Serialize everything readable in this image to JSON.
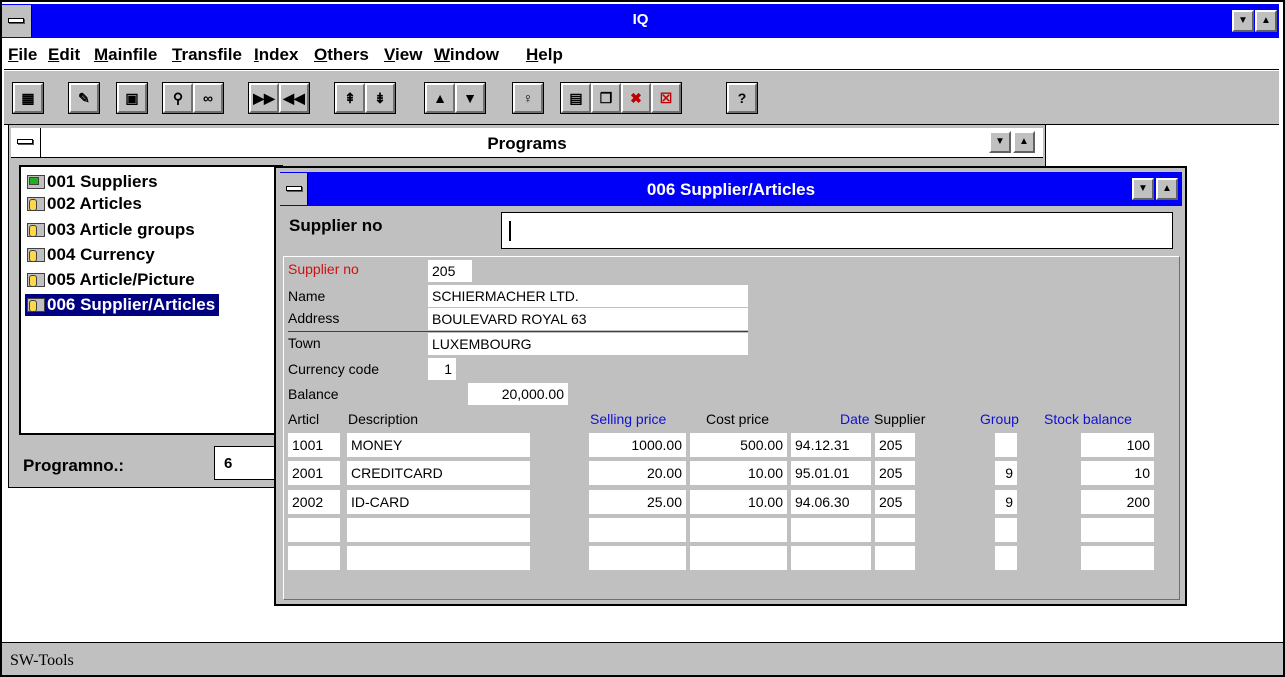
{
  "app": {
    "title": "IQ"
  },
  "menu": [
    "File",
    "Edit",
    "Mainfile",
    "Transfile",
    "Index",
    "Others",
    "View",
    "Window",
    "Help"
  ],
  "menu_underline": [
    "F",
    "E",
    "M",
    "T",
    "I",
    "O",
    "V",
    "W",
    "H"
  ],
  "toolbar": {
    "buttons": [
      "calculator-icon",
      "edit-note-icon",
      "save-icon",
      "search-icon",
      "glasses-icon",
      "next-record-icon",
      "previous-record-icon",
      "first-icon",
      "last-icon",
      "up-icon",
      "down-icon",
      "lightbulb-icon",
      "window-layout-icon",
      "cascade-icon",
      "delete-record-icon",
      "close-record-icon",
      "help-icon"
    ]
  },
  "programs": {
    "title": "Programs",
    "items": [
      {
        "label": "001  Suppliers"
      },
      {
        "label": "002  Articles"
      },
      {
        "label": "003  Article groups"
      },
      {
        "label": "004  Currency"
      },
      {
        "label": "005  Article/Picture"
      },
      {
        "label": "006  Supplier/Articles"
      }
    ],
    "selected_index": 5,
    "programno_label": "Programno.:",
    "programno_value": "6"
  },
  "supplier_window": {
    "title": "006  Supplier/Articles",
    "key_label": "Supplier no",
    "key_value": "",
    "fields": {
      "supplier_no_label": "Supplier no",
      "supplier_no": "205",
      "name_label": "Name",
      "name": "SCHIERMACHER LTD.",
      "address_label": "Address",
      "address": "BOULEVARD ROYAL 63",
      "town_label": "Town",
      "town": "LUXEMBOURG",
      "currency_label": "Currency code",
      "currency": "1",
      "balance_label": "Balance",
      "balance": "20,000.00"
    },
    "table": {
      "headers": {
        "articl": "Articl",
        "description": "Description",
        "selling_price": "Selling price",
        "cost_price": "Cost price",
        "date": "Date",
        "supplier": "Supplier",
        "group": "Group",
        "stock_balance": "Stock balance"
      },
      "rows": [
        {
          "articl": "1001",
          "description": "MONEY",
          "selling_price": "1000.00",
          "cost_price": "500.00",
          "date": "94.12.31",
          "supplier": "205",
          "group": "",
          "stock_balance": "100"
        },
        {
          "articl": "2001",
          "description": "CREDITCARD",
          "selling_price": "20.00",
          "cost_price": "10.00",
          "date": "95.01.01",
          "supplier": "205",
          "group": "9",
          "stock_balance": "10"
        },
        {
          "articl": "2002",
          "description": "ID-CARD",
          "selling_price": "25.00",
          "cost_price": "10.00",
          "date": "94.06.30",
          "supplier": "205",
          "group": "9",
          "stock_balance": "200"
        },
        {
          "articl": "",
          "description": "",
          "selling_price": "",
          "cost_price": "",
          "date": "",
          "supplier": "",
          "group": "",
          "stock_balance": ""
        },
        {
          "articl": "",
          "description": "",
          "selling_price": "",
          "cost_price": "",
          "date": "",
          "supplier": "",
          "group": "",
          "stock_balance": ""
        }
      ]
    }
  },
  "status": {
    "text": "SW-Tools"
  },
  "colors": {
    "title_active": "#0000f8",
    "selection": "#000080",
    "face": "#c0c0c0",
    "label_red": "#d01010",
    "label_blue": "#1010d0"
  }
}
